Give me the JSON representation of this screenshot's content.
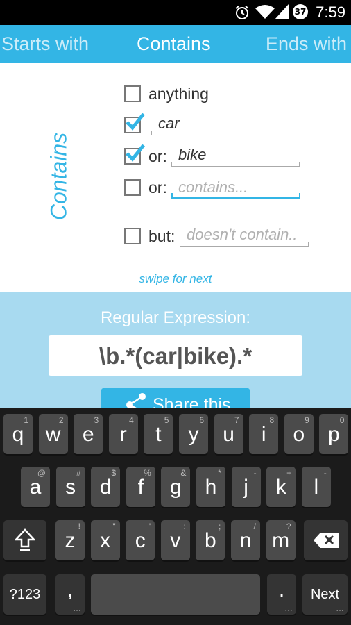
{
  "status_bar": {
    "time": "7:59",
    "battery_level": "37"
  },
  "tabs": {
    "left": "Starts with",
    "active": "Contains",
    "right": "Ends with"
  },
  "side_title": "Contains",
  "options": {
    "anything": {
      "label": "anything",
      "checked": false
    },
    "term1": {
      "checked": true,
      "value": "car"
    },
    "term2": {
      "checked": true,
      "prefix": "or:",
      "value": "bike"
    },
    "term3": {
      "checked": false,
      "prefix": "or:",
      "placeholder": "contains..."
    },
    "exclude": {
      "checked": false,
      "prefix": "but:",
      "placeholder": "doesn't contain.."
    }
  },
  "swipe_hint": "swipe for next",
  "regex": {
    "title": "Regular Expression:",
    "value": "\\b.*(car|bike).*"
  },
  "share_label": "Share this",
  "keyboard": {
    "row1": [
      [
        "q",
        "1"
      ],
      [
        "w",
        "2"
      ],
      [
        "e",
        "3"
      ],
      [
        "r",
        "4"
      ],
      [
        "t",
        "5"
      ],
      [
        "y",
        "6"
      ],
      [
        "u",
        "7"
      ],
      [
        "i",
        "8"
      ],
      [
        "o",
        "9"
      ],
      [
        "p",
        "0"
      ]
    ],
    "row2": [
      [
        "a",
        "@"
      ],
      [
        "s",
        "#"
      ],
      [
        "d",
        "$"
      ],
      [
        "f",
        "%"
      ],
      [
        "g",
        "&"
      ],
      [
        "h",
        "*"
      ],
      [
        "j",
        "-"
      ],
      [
        "k",
        "+"
      ],
      [
        "l",
        "-"
      ]
    ],
    "row3": [
      [
        "z",
        "!"
      ],
      [
        "x",
        "\""
      ],
      [
        "c",
        "'"
      ],
      [
        "v",
        ":"
      ],
      [
        "b",
        ";"
      ],
      [
        "n",
        "/"
      ],
      [
        "m",
        "?"
      ]
    ],
    "symbols_key": "?123",
    "comma_key": ",",
    "period_key": ".",
    "next_key": "Next"
  },
  "colors": {
    "accent": "#33b5e5",
    "panel": "#a8daf0"
  }
}
